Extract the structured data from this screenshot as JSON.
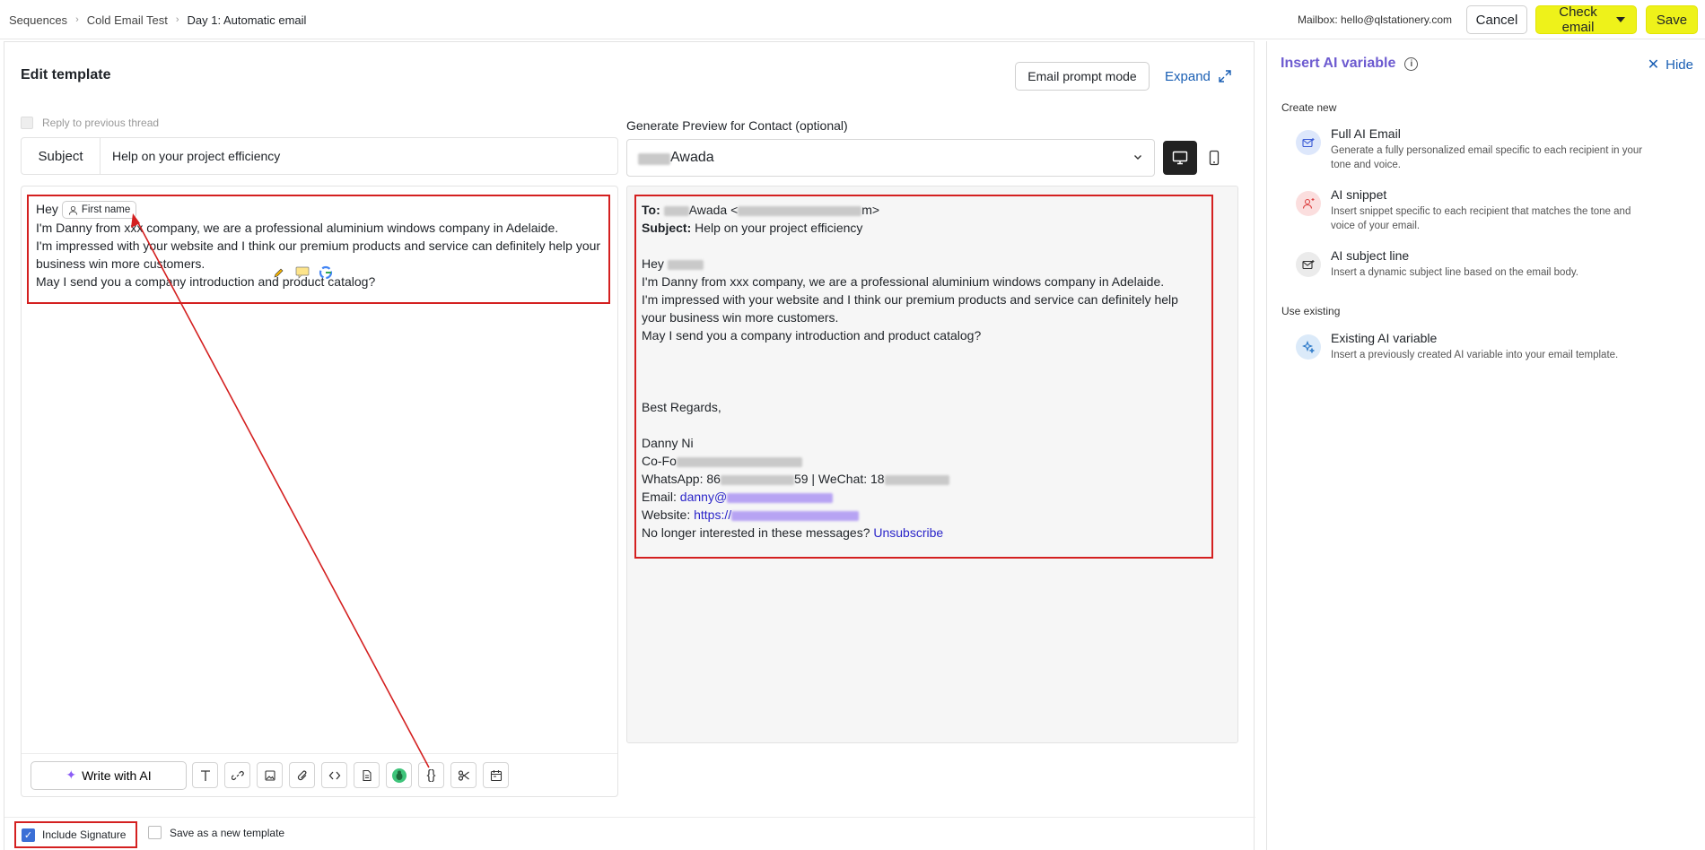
{
  "breadcrumb": [
    "Sequences",
    "Cold Email Test",
    "Day 1: Automatic email"
  ],
  "header": {
    "mailbox": "Mailbox: hello@qlstationery.com",
    "cancel_label": "Cancel",
    "check_label": "Check email",
    "save_label": "Save"
  },
  "editor": {
    "title": "Edit template",
    "prompt_mode_label": "Email prompt mode",
    "expand_label": "Expand",
    "reply_label": "Reply to previous thread",
    "subject_label": "Subject",
    "subject_value": "Help on your project efficiency",
    "greeting": "Hey",
    "variable_chip": "First name",
    "body_lines": [
      "I'm Danny from xxx company, we are a professional aluminium windows company in Adelaide.",
      "I'm impressed with your website and I think our premium products and service can definitely help your business win more customers.",
      "May I send you a company introduction and product catalog?"
    ],
    "write_ai_label": "Write with AI",
    "toolbar_icons": [
      "text-icon",
      "link-icon",
      "image-icon",
      "attachment-icon",
      "code-icon",
      "document-icon",
      "bug-icon",
      "variable-braces-icon",
      "scissors-icon",
      "calendar-icon"
    ]
  },
  "preview": {
    "label": "Generate Preview for Contact (optional)",
    "contact_name": "Awada",
    "to_label": "To:",
    "to_value": "Awada <",
    "to_tail": "m>",
    "subject_label": "Subject:",
    "subject_value": "Help on your project efficiency",
    "greeting": "Hey",
    "body_lines": [
      "I'm Danny from xxx company, we are a professional aluminium windows company in Adelaide.",
      "I'm impressed with your website and I think our premium products and service can definitely help your business win more customers.",
      "May I send you a company introduction and product catalog?"
    ],
    "regards": "Best Regards,",
    "sig_name": "Danny Ni",
    "sig_title": "Co-Fo",
    "sig_whatsapp": "WhatsApp: 86",
    "sig_whatsapp_mid": "59 | WeChat: 18",
    "sig_email_label": "Email: ",
    "sig_email": "danny@",
    "sig_website_label": "Website: ",
    "sig_website": "https://",
    "unsub_text": "No longer interested in these messages? ",
    "unsub_link": "Unsubscribe"
  },
  "footer": {
    "include_signature": "Include Signature",
    "save_template": "Save as a new template"
  },
  "ai_panel": {
    "title": "Insert AI variable",
    "hide_label": "Hide",
    "create_new": "Create new",
    "use_existing": "Use existing",
    "options": [
      {
        "title": "Full AI Email",
        "desc": "Generate a fully personalized email specific to each recipient in your tone and voice."
      },
      {
        "title": "AI snippet",
        "desc": "Insert snippet specific to each recipient that matches the tone and voice of your email."
      },
      {
        "title": "AI subject line",
        "desc": "Insert a dynamic subject line based on the email body."
      }
    ],
    "existing": {
      "title": "Existing AI variable",
      "desc": "Insert a previously created AI variable into your email template."
    }
  },
  "colors": {
    "accent_yellow": "#eef21a",
    "highlight_red": "#d42020",
    "link_blue": "#1a5fb4",
    "ai_purple": "#6d5bd0"
  }
}
